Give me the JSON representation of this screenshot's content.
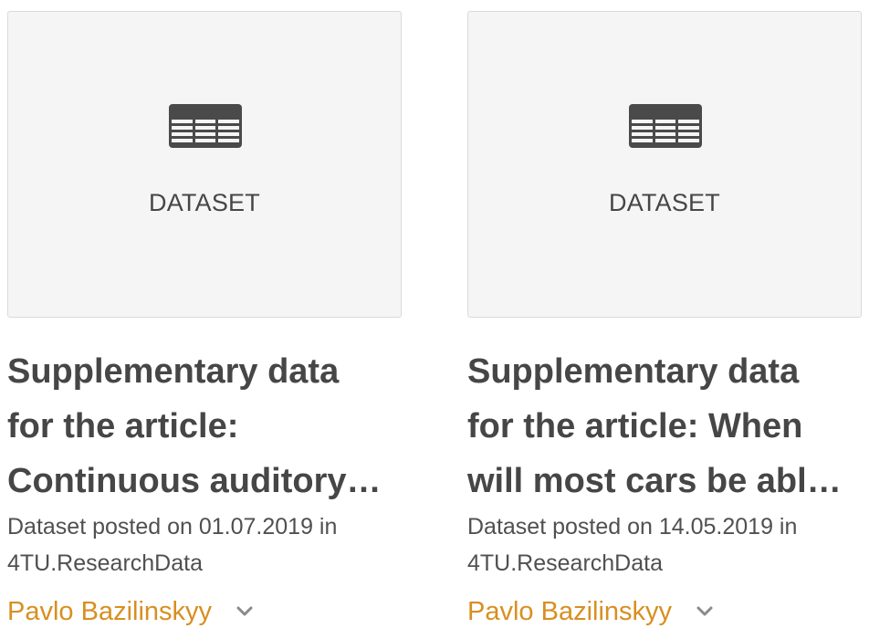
{
  "cards": [
    {
      "thumbnail_label": "DATASET",
      "thumbnail_icon": "table-icon",
      "title_lines": [
        "Supplementary data",
        "for the article:",
        "Continuous auditory…"
      ],
      "meta_line1": "Dataset posted on 01.07.2019 in",
      "portal": "4TU.ResearchData",
      "author": "Pavlo Bazilinskyy",
      "expand_icon": "chevron-down-icon"
    },
    {
      "thumbnail_label": "DATASET",
      "thumbnail_icon": "table-icon",
      "title_lines": [
        "Supplementary data",
        "for the article: When",
        "will most cars be abl…"
      ],
      "meta_line1": "Dataset posted on 14.05.2019 in",
      "portal": "4TU.ResearchData",
      "author": "Pavlo Bazilinskyy",
      "expand_icon": "chevron-down-icon"
    }
  ],
  "colors": {
    "text": "#464646",
    "author": "#d88f20",
    "thumbnail_bg": "#f5f5f5",
    "thumbnail_border": "#dadada"
  }
}
